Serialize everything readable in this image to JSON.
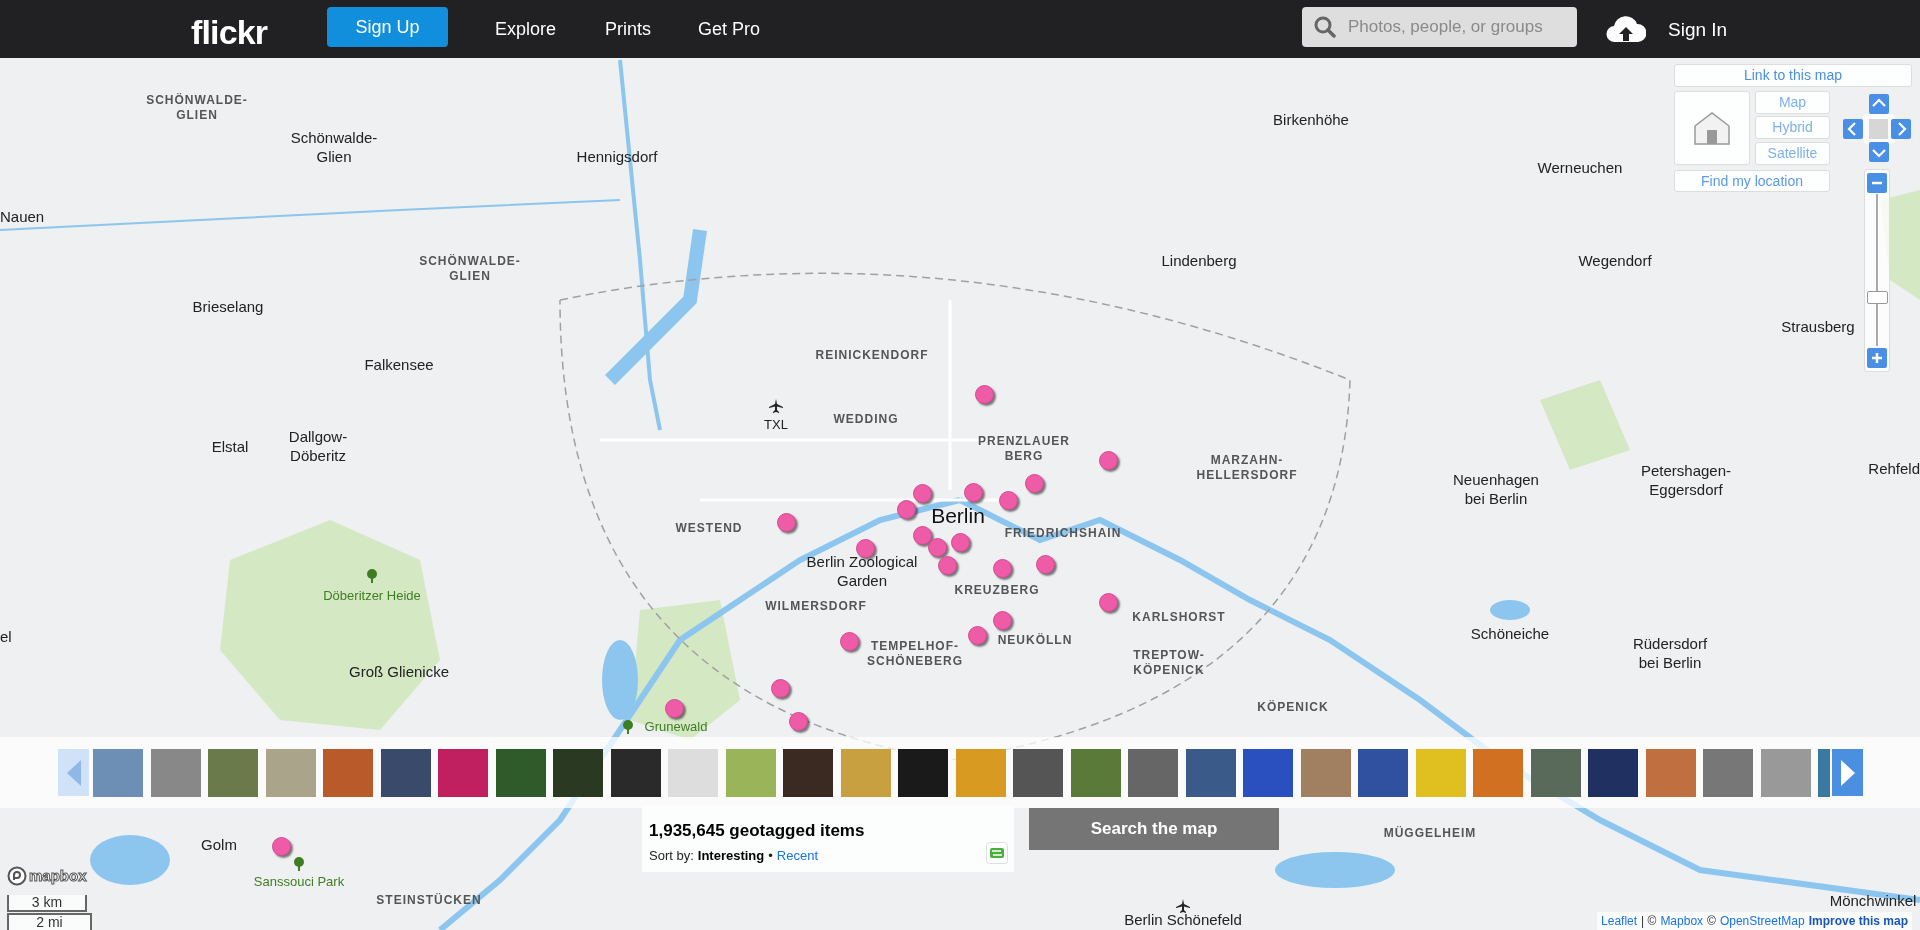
{
  "header": {
    "logo": "flickr",
    "signup": "Sign Up",
    "nav": [
      "Explore",
      "Prints",
      "Get Pro"
    ],
    "search": {
      "placeholder": "Photos, people, or groups"
    },
    "signin": "Sign In"
  },
  "map_controls": {
    "link": "Link to this map",
    "map_types": [
      "Map",
      "Hybrid",
      "Satellite"
    ],
    "find_location": "Find my location"
  },
  "places": [
    {
      "kind": "district",
      "text": "SCHÖNWALDE-\nGLIEN"
    },
    {
      "kind": "town",
      "text": "Birkenhöhe"
    },
    {
      "kind": "town",
      "text": "Schönwalde-\nGlien"
    },
    {
      "kind": "town",
      "text": "Hennigsdorf"
    },
    {
      "kind": "town",
      "text": "Werneuchen"
    },
    {
      "kind": "town",
      "text": "Nauen"
    },
    {
      "kind": "district",
      "text": "SCHÖNWALDE-\nGLIEN"
    },
    {
      "kind": "town",
      "text": "Lindenberg"
    },
    {
      "kind": "town",
      "text": "Wegendorf"
    },
    {
      "kind": "town",
      "text": "Brieselang"
    },
    {
      "kind": "town",
      "text": "Strausberg"
    },
    {
      "kind": "town",
      "text": "Falkensee"
    },
    {
      "kind": "district",
      "text": "REINICKENDORF"
    },
    {
      "kind": "airport",
      "text": "TXL"
    },
    {
      "kind": "district",
      "text": "WEDDING"
    },
    {
      "kind": "town",
      "text": "Elstal"
    },
    {
      "kind": "town",
      "text": "Dallgow-\nDöberitz"
    },
    {
      "kind": "district",
      "text": "PRENZLAUER\nBERG"
    },
    {
      "kind": "district",
      "text": "MARZAHN-\nHELLERSDORF"
    },
    {
      "kind": "town",
      "text": "Neuenhagen\nbei Berlin"
    },
    {
      "kind": "town",
      "text": "Petershagen-\nEggersdorf"
    },
    {
      "kind": "town",
      "text": "Rehfeld"
    },
    {
      "kind": "district",
      "text": "WESTEND"
    },
    {
      "kind": "city",
      "text": "Berlin"
    },
    {
      "kind": "district",
      "text": "FRIEDRICHSHAIN"
    },
    {
      "kind": "town",
      "text": "Berlin Zoological\nGarden"
    },
    {
      "kind": "district",
      "text": "KREUZBERG"
    },
    {
      "kind": "park",
      "text": "Döberitzer Heide"
    },
    {
      "kind": "district",
      "text": "WILMERSDORF"
    },
    {
      "kind": "district",
      "text": "KARLSHORST"
    },
    {
      "kind": "town",
      "text": "el"
    },
    {
      "kind": "district",
      "text": "TEMPELHOF-\nSCHÖNEBERG"
    },
    {
      "kind": "district",
      "text": "NEUKÖLLN"
    },
    {
      "kind": "town",
      "text": "Schöneiche"
    },
    {
      "kind": "town",
      "text": "Rüdersdorf\nbei Berlin"
    },
    {
      "kind": "town",
      "text": "Groß Glienicke"
    },
    {
      "kind": "district",
      "text": "TREPTOW-\nKÖPENICK"
    },
    {
      "kind": "district",
      "text": "KÖPENICK"
    },
    {
      "kind": "park",
      "text": "Grunewald"
    },
    {
      "kind": "town",
      "text": "Golm"
    },
    {
      "kind": "district",
      "text": "MÜGGELHEIM"
    },
    {
      "kind": "park",
      "text": "Sanssouci Park"
    },
    {
      "kind": "district",
      "text": "STEINSTÜCKEN"
    },
    {
      "kind": "town",
      "text": "Berlin Schönefeld"
    },
    {
      "kind": "town",
      "text": "Mönchwinkel"
    }
  ],
  "results": {
    "count": "1,935,645 geotagged items",
    "sort_label": "Sort by:",
    "sort_options": [
      {
        "label": "Interesting",
        "selected": true
      },
      {
        "label": "Recent",
        "selected": false
      }
    ],
    "separator": "•"
  },
  "search_button": "Search the map",
  "mapbox_logo": "mapbox",
  "scale": [
    "3 km",
    "2 mi"
  ],
  "attribution": [
    {
      "kind": "link",
      "text": "Leaflet"
    },
    {
      "kind": "text",
      "text": "| ©"
    },
    {
      "kind": "link",
      "text": "Mapbox"
    },
    {
      "kind": "text",
      "text": "©"
    },
    {
      "kind": "link",
      "text": "OpenStreetMap"
    },
    {
      "kind": "strong",
      "text": "Improve this map"
    }
  ]
}
